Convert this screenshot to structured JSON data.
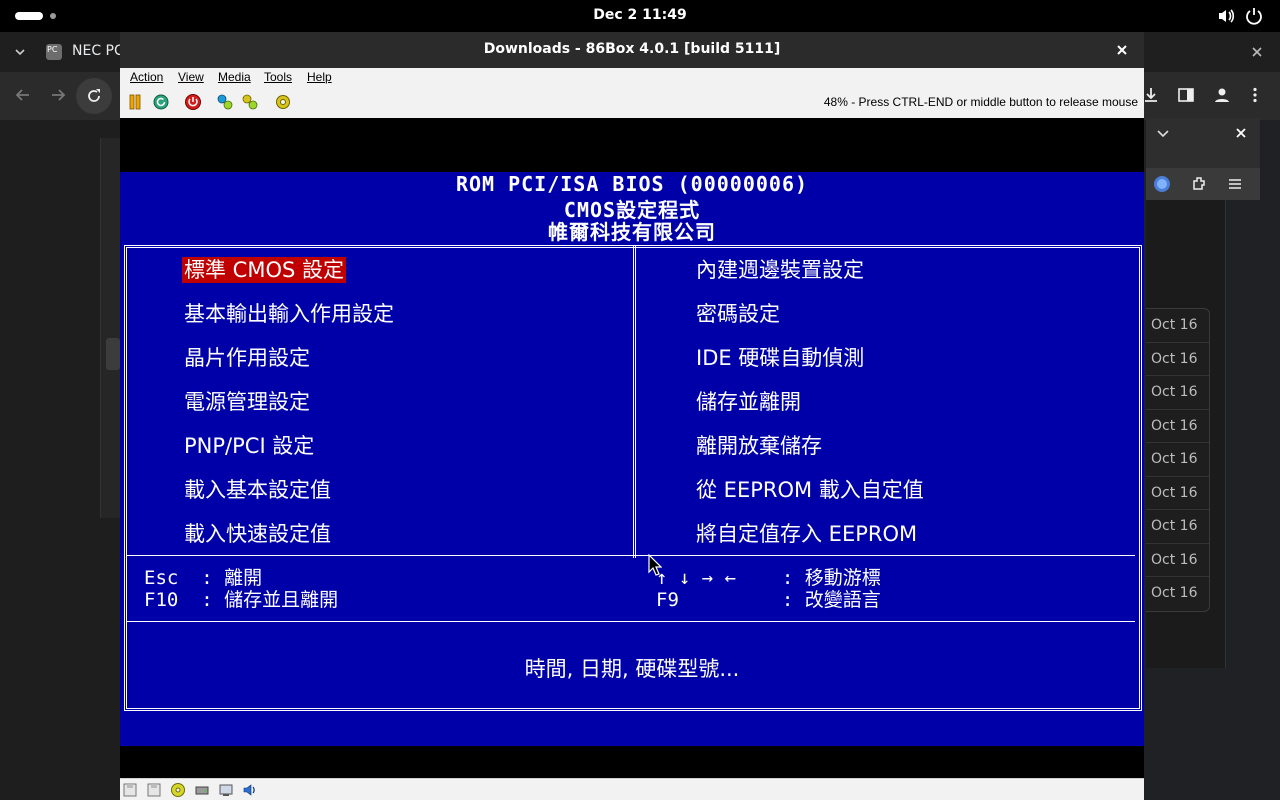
{
  "system": {
    "clock": "Dec 2  11:49"
  },
  "browser": {
    "tab_title": "NEC PC",
    "tab_favicon_text": "PC",
    "dates": [
      "Oct 16",
      "Oct 16",
      "Oct 16",
      "Oct 16",
      "Oct 16",
      "Oct 16",
      "Oct 16",
      "Oct 16",
      "Oct 16"
    ]
  },
  "window": {
    "title": "Downloads - 86Box 4.0.1 [build 5111]"
  },
  "menu": [
    "Action",
    "View",
    "Media",
    "Tools",
    "Help"
  ],
  "toolbar": {
    "status": "48% - Press CTRL-END or middle button to release mouse"
  },
  "bios": {
    "header": [
      "ROM PCI/ISA BIOS (00000006)",
      "CMOS設定程式",
      "帷爾科技有限公司"
    ],
    "left_items": [
      "標準 CMOS 設定",
      "基本輸出輸入作用設定",
      "晶片作用設定",
      "電源管理設定",
      "PNP/PCI 設定",
      "載入基本設定值",
      "載入快速設定值"
    ],
    "right_items": [
      "內建週邊裝置設定",
      "密碼設定",
      "IDE 硬碟自動偵測",
      "儲存並離開",
      "離開放棄儲存",
      "從 EEPROM 載入自定值",
      "將自定值存入 EEPROM"
    ],
    "keys_left": [
      "Esc  : 離開",
      "F10  : 儲存並且離開"
    ],
    "keys_right": [
      "↑ ↓ → ←    : 移動游標",
      "F9         : 改變語言"
    ],
    "help": "時間, 日期, 硬碟型號..."
  }
}
